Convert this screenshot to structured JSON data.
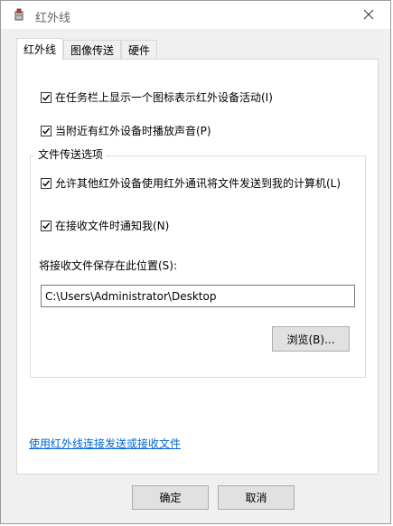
{
  "window": {
    "title": "红外线",
    "close_glyph": "✕"
  },
  "tabs": [
    {
      "label": "红外线",
      "active": true
    },
    {
      "label": "图像传送",
      "active": false
    },
    {
      "label": "硬件",
      "active": false
    }
  ],
  "options": {
    "show_taskbar_icon": {
      "label": "在任务栏上显示一个图标表示红外设备活动(I)",
      "checked": true
    },
    "play_sound": {
      "label": "当附近有红外设备时播放声音(P)",
      "checked": true
    }
  },
  "file_transfer": {
    "legend": "文件传送选项",
    "allow_send": {
      "label": "允许其他红外设备使用红外通讯将文件发送到我的计算机(L)",
      "checked": true
    },
    "notify_receive": {
      "label": "在接收文件时通知我(N)",
      "checked": true
    },
    "save_location_label": "将接收文件保存在此位置(S):",
    "save_location_value": "C:\\Users\\Administrator\\Desktop",
    "browse_label": "浏览(B)..."
  },
  "help_link": "使用红外线连接发送或接收文件",
  "footer": {
    "ok_label": "确定",
    "cancel_label": "取消"
  },
  "colors": {
    "link": "#0066cc",
    "dialog_bg": "#f0f0f0",
    "panel_bg": "#ffffff"
  }
}
